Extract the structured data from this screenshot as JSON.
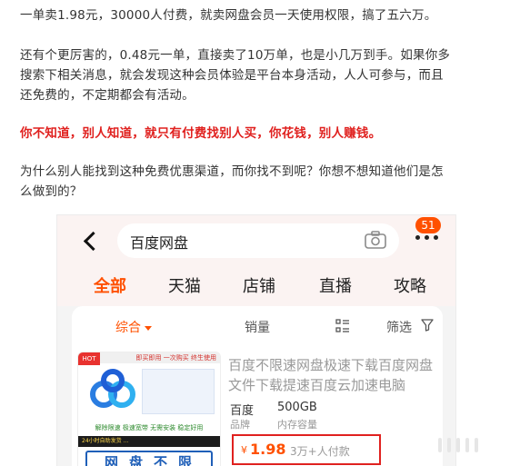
{
  "article": {
    "p1": "一单卖1.98元，30000人付费，就卖网盘会员一天使用权限，搞了五六万。",
    "p2_line1": "还有个更厉害的，0.48元一单，直接卖了10万单，也是小几万到手。如果你多",
    "p2_line2": "搜索下相关消息，就会发现这种会员体验是平台本身活动，人人可参与，而且",
    "p2_line3": "还免费的，不定期都会有活动。",
    "p3": "你不知道，别人知道，就只有付费找别人买，你花钱，别人赚钱。",
    "p4_line1": "为什么别人能找到这种免费优惠渠道，而你找不到呢？你想不想知道他们是怎",
    "p4_line2": "么做到的？"
  },
  "screenshot": {
    "search_query": "百度网盘",
    "message_badge": "51",
    "tabs": [
      "全部",
      "天猫",
      "店铺",
      "直播",
      "攻略"
    ],
    "sort": {
      "default_label": "综合",
      "sales_label": "销量",
      "filter_label": "筛选"
    },
    "product": {
      "thumb_hot": "HOT",
      "thumb_top": "即买即用 一次购买 终生使用",
      "thumb_green": "解除限速 极速宽带 无需安装 稳定好用",
      "thumb_dark": "24小时自助发货 ...",
      "thumb_bottom": "网盘不限速",
      "title": "百度不限速网盘极速下载百度网盘文件下载提速百度云加速电脑",
      "spec_brand_value": "百度",
      "spec_capacity_value": "500GB",
      "spec_brand_key": "品牌",
      "spec_capacity_key": "内存容量",
      "price_symbol": "¥",
      "price": "1.98",
      "paid_count": "3万+人付款"
    }
  },
  "colors": {
    "accent": "#ff5000",
    "highlight_red": "#e0211f"
  }
}
